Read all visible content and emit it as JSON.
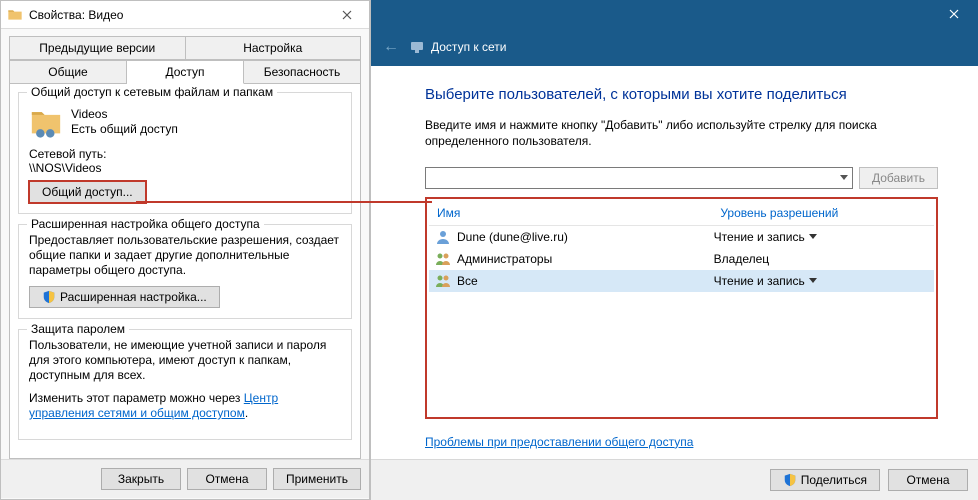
{
  "props": {
    "title": "Свойства: Видео",
    "tabs_top": [
      "Предыдущие версии",
      "Настройка"
    ],
    "tabs_bottom": [
      "Общие",
      "Доступ",
      "Безопасность"
    ],
    "active_tab": "Доступ",
    "share_group": {
      "title": "Общий доступ к сетевым файлам и папкам",
      "folder_name": "Videos",
      "folder_status": "Есть общий доступ",
      "netpath_label": "Сетевой путь:",
      "netpath_value": "\\\\NOS\\Videos",
      "share_btn": "Общий доступ..."
    },
    "adv_group": {
      "title": "Расширенная настройка общего доступа",
      "desc": "Предоставляет пользовательские разрешения, создает общие папки и задает другие дополнительные параметры общего доступа.",
      "btn": "Расширенная настройка..."
    },
    "pwd_group": {
      "title": "Защита паролем",
      "desc": "Пользователи, не имеющие учетной записи и пароля для этого компьютера, имеют доступ к папкам, доступным для всех.",
      "change_prefix": "Изменить этот параметр можно через ",
      "link": "Центр управления сетями и общим доступом",
      "suffix": "."
    },
    "footer": {
      "close": "Закрыть",
      "cancel": "Отмена",
      "apply": "Применить"
    }
  },
  "wizard": {
    "crumb": "Доступ к сети",
    "heading": "Выберите пользователей, с которыми вы хотите поделиться",
    "desc": "Введите имя и нажмите кнопку \"Добавить\" либо используйте стрелку для поиска определенного пользователя.",
    "add_btn": "Добавить",
    "columns": {
      "name": "Имя",
      "perm": "Уровень разрешений"
    },
    "rows": [
      {
        "icon": "user",
        "name": "Dune  (dune@live.ru)",
        "perm": "Чтение и запись",
        "combo": true,
        "selected": false
      },
      {
        "icon": "group",
        "name": "Администраторы",
        "perm": "Владелец",
        "combo": false,
        "selected": false
      },
      {
        "icon": "group",
        "name": "Все",
        "perm": "Чтение и запись",
        "combo": true,
        "selected": true
      }
    ],
    "trouble_link": "Проблемы при предоставлении общего доступа",
    "footer": {
      "share": "Поделиться",
      "cancel": "Отмена"
    }
  }
}
